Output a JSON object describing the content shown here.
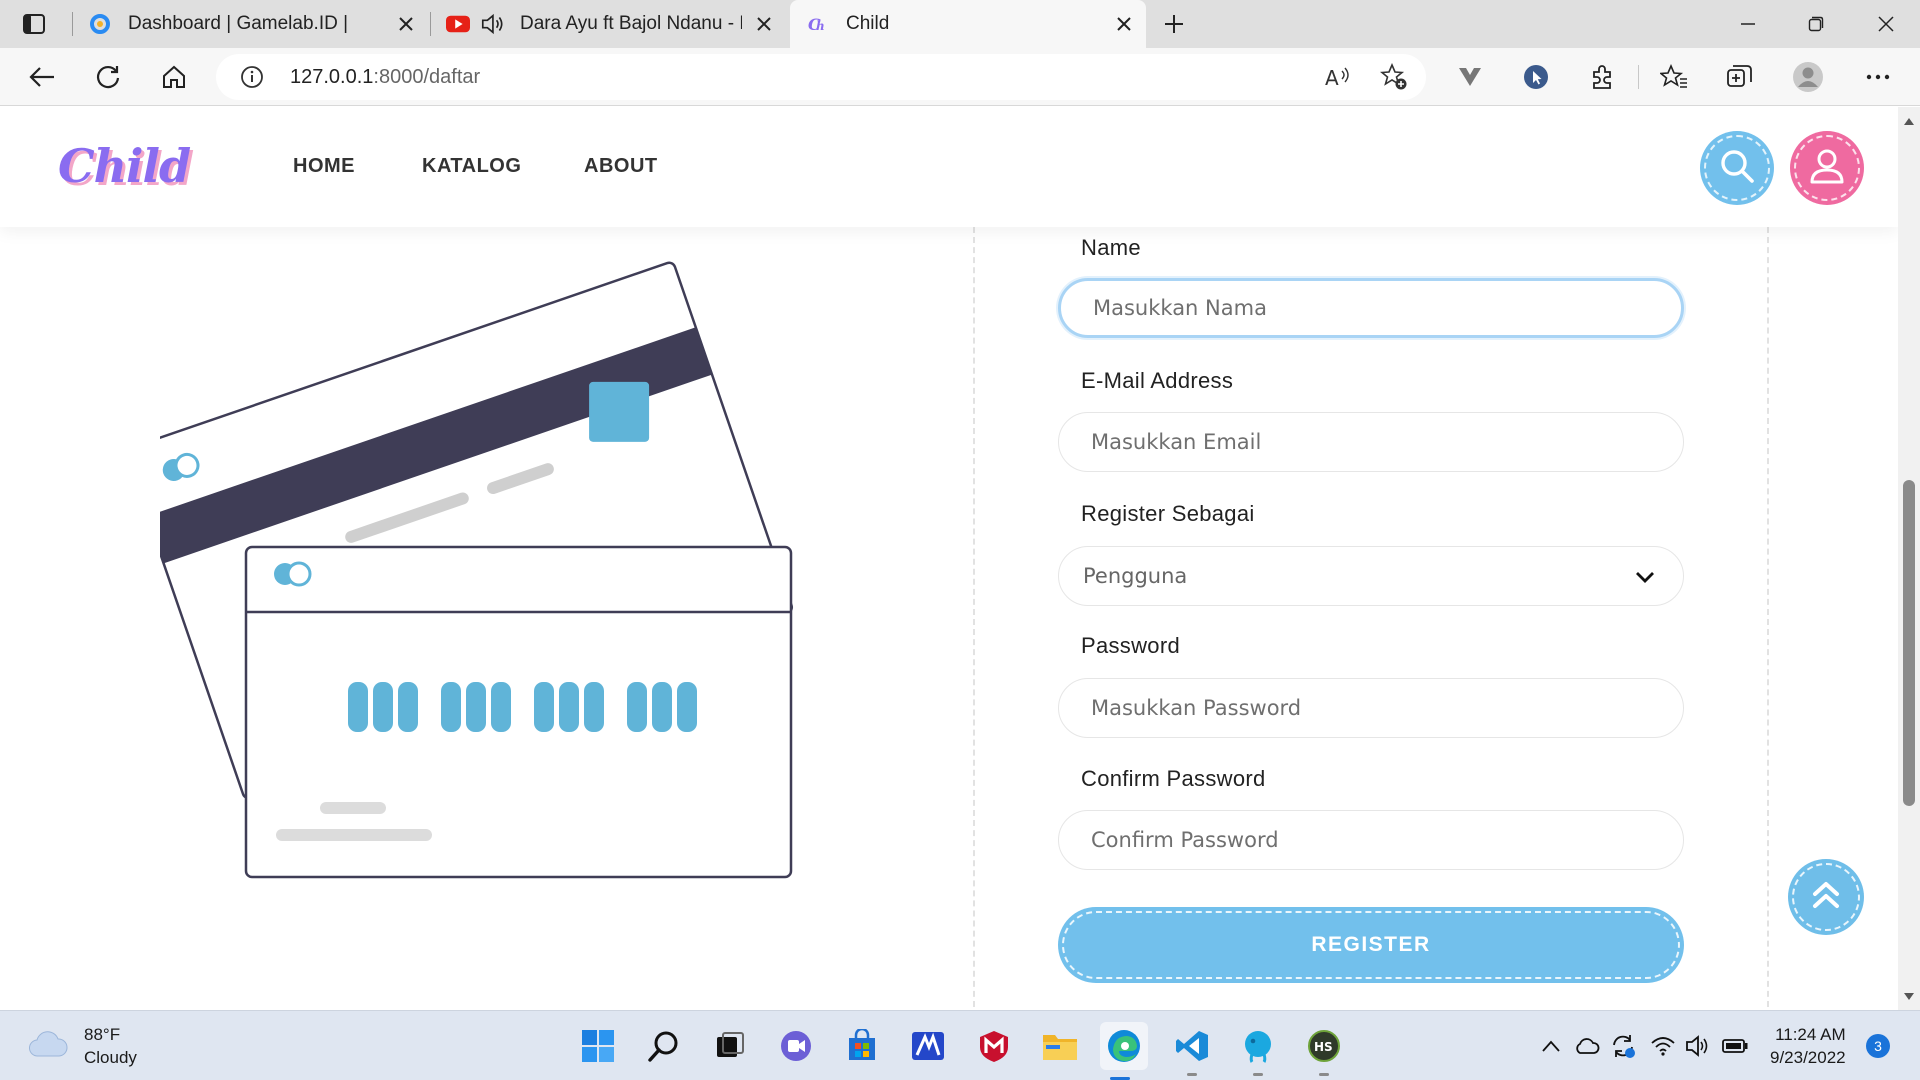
{
  "browser": {
    "tabs": [
      {
        "title": "Dashboard | Gamelab.ID | Optim",
        "favicon": "gamelab-icon",
        "active": false
      },
      {
        "title": "Dara Ayu ft Bajol Ndanu - R",
        "favicon": "youtube-icon",
        "audio": true,
        "active": false
      },
      {
        "title": "Child",
        "favicon": "child-icon",
        "active": true
      }
    ],
    "url_host": "127.0.0.1",
    "url_path": ":8000/daftar"
  },
  "site": {
    "logo": "Child",
    "nav": [
      "HOME",
      "KATALOG",
      "ABOUT"
    ],
    "colors": {
      "accent_blue": "#72c0ec",
      "accent_pink": "#ef6aa0",
      "logo_purple": "#8a6cf0"
    }
  },
  "form": {
    "name_label": "Name",
    "name_placeholder": "Masukkan Nama",
    "email_label": "E-Mail Address",
    "email_placeholder": "Masukkan Email",
    "role_label": "Register Sebagai",
    "role_value": "Pengguna",
    "password_label": "Password",
    "password_placeholder": "Masukkan Password",
    "confirm_label": "Confirm Password",
    "confirm_placeholder": "Confirm Password",
    "submit": "REGISTER"
  },
  "taskbar": {
    "weather_temp": "88°F",
    "weather_desc": "Cloudy",
    "time": "11:24 AM",
    "date": "9/23/2022",
    "notifications": "3"
  }
}
